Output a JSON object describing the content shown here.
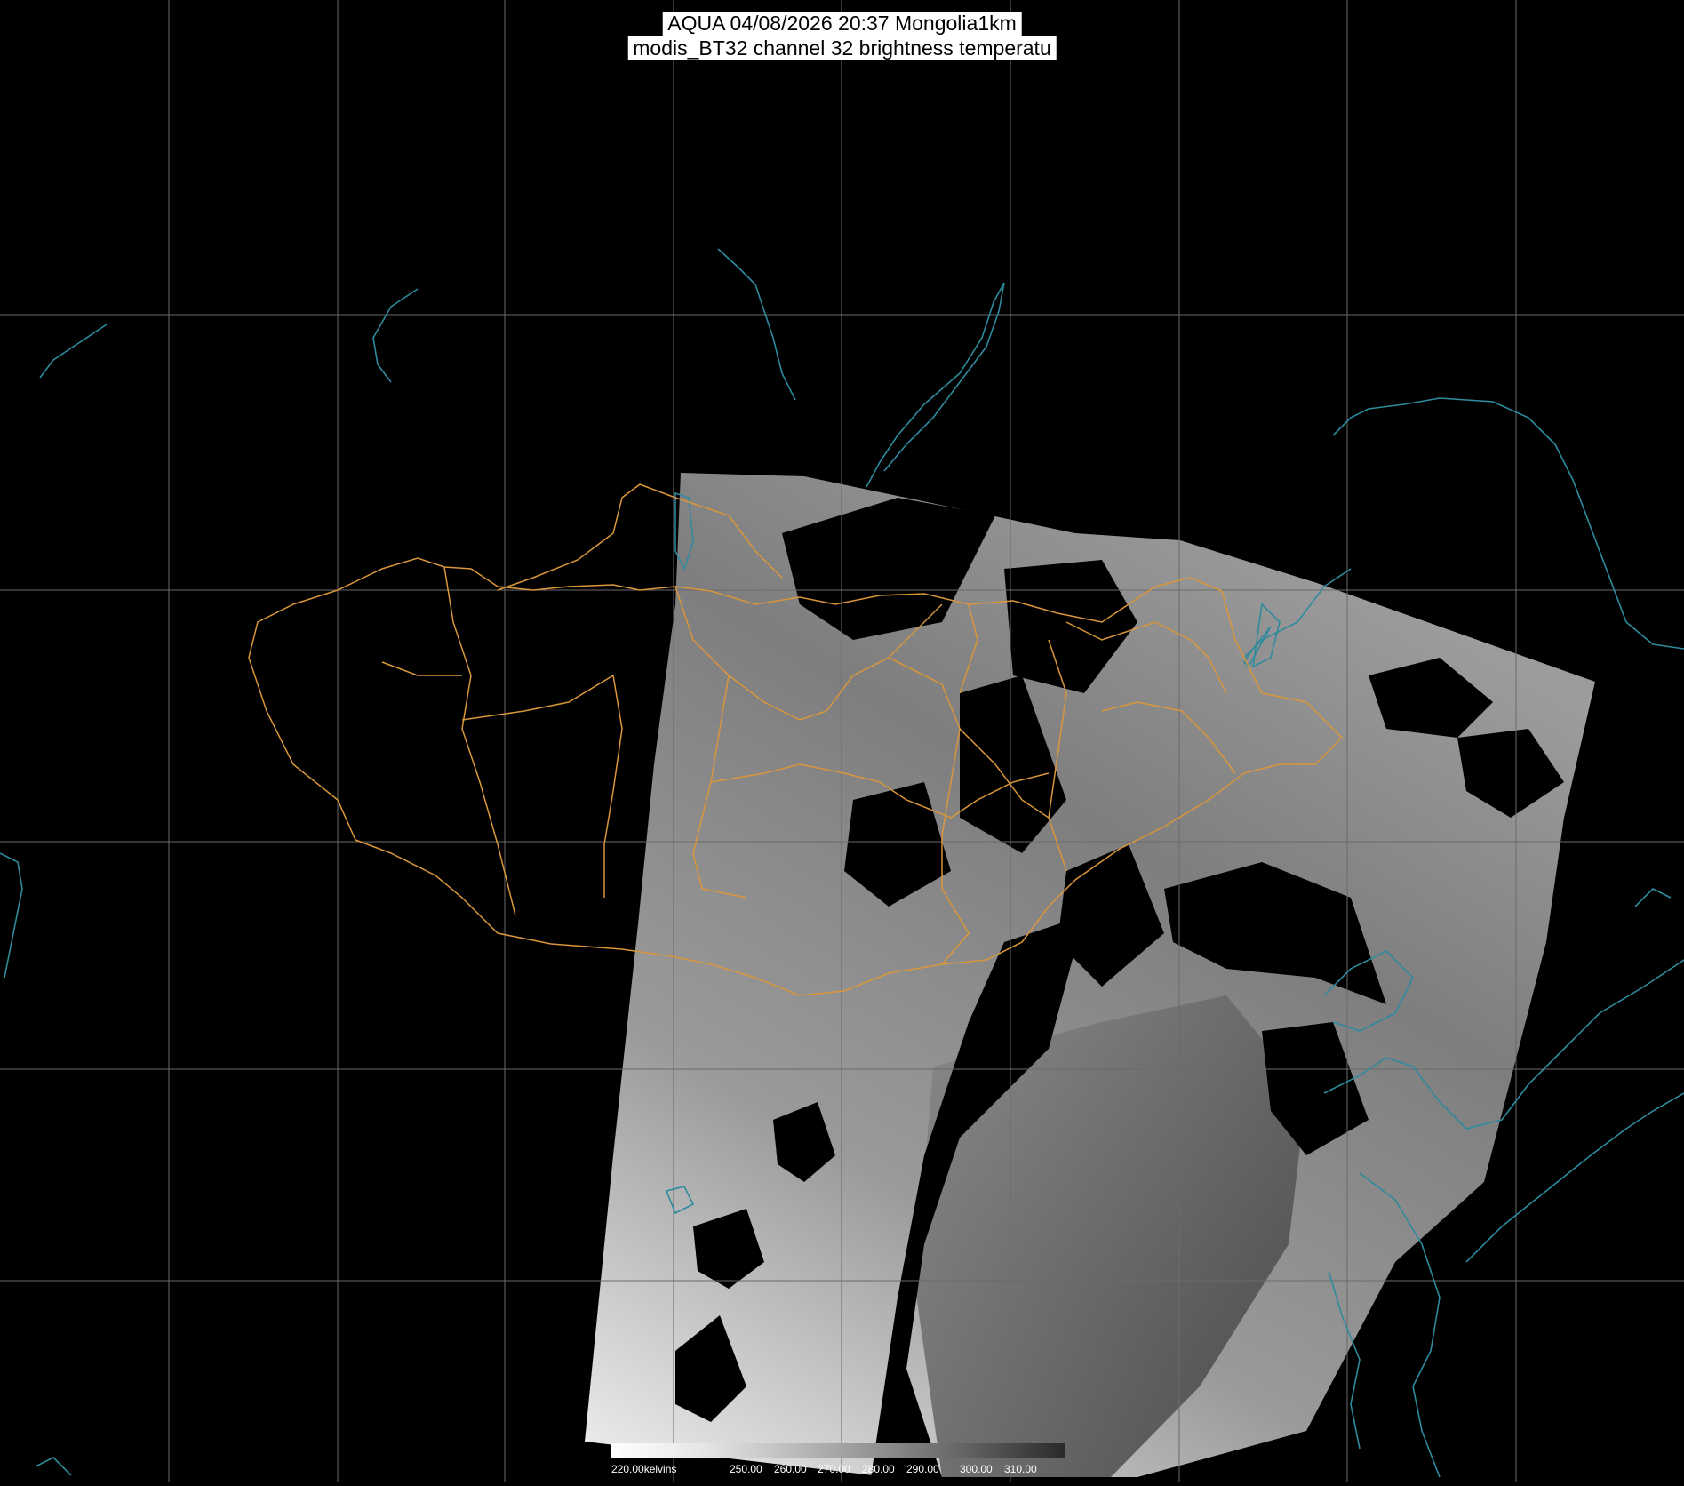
{
  "title": {
    "line1": "AQUA 04/08/2026 20:37 Mongolia1km",
    "line2": "modis_BT32 channel 32 brightness temperatu"
  },
  "colorbar": {
    "labels": [
      "220.00kelvins",
      "250.00",
      "260.00",
      "270.00",
      "280.00",
      "290.00",
      "300.00",
      "310.00"
    ]
  },
  "colors": {
    "background": "#000000",
    "graticule": "#6a6a6a",
    "coastline": "#2f8a9e",
    "admin_border": "#d9963a",
    "swath_light": "#e8e8e8",
    "swath_dark": "#3a3a3a"
  }
}
